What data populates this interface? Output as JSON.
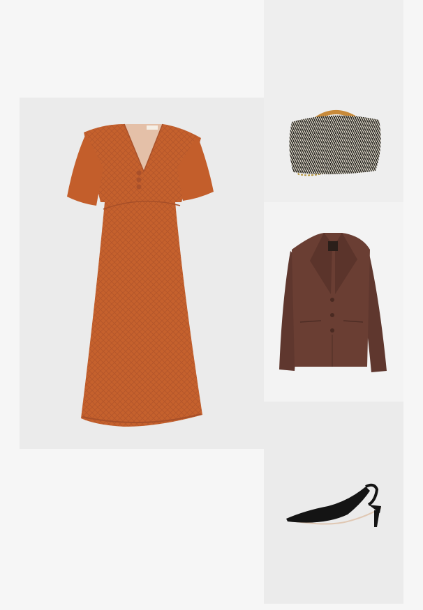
{
  "outfit": {
    "items": [
      {
        "icon": "dress-image",
        "color": "#c8642f"
      },
      {
        "icon": "handbag-image",
        "color": "#2e2a24"
      },
      {
        "icon": "blazer-image",
        "color": "#6a3e33"
      },
      {
        "icon": "slingback-shoe-image",
        "color": "#141414"
      }
    ],
    "colors": {
      "page_background": "#f6f6f6",
      "tile_background": "#ebebeb",
      "bamboo_handle": "#c88a3a",
      "chain_strap": "#b5953e"
    }
  }
}
